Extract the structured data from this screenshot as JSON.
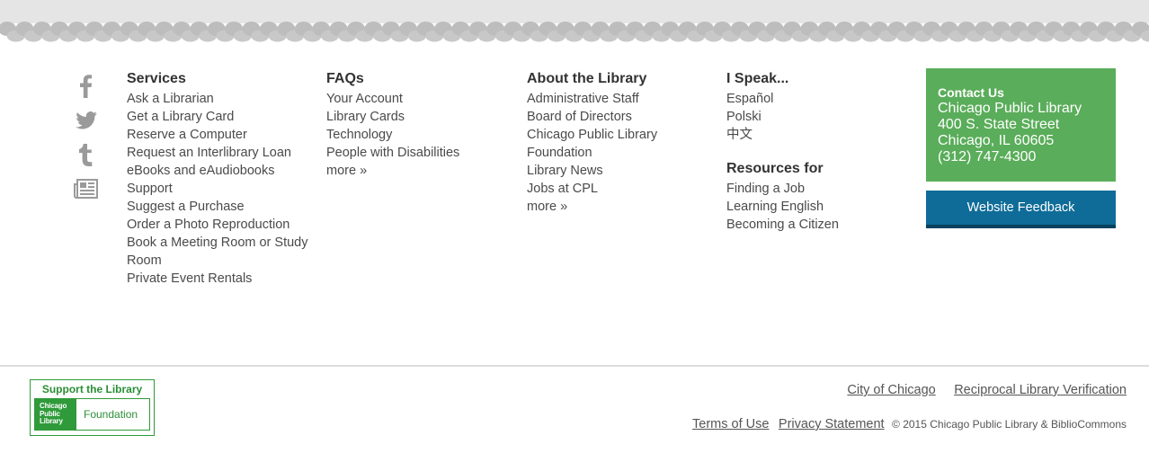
{
  "social": {
    "icons": [
      "facebook-icon",
      "twitter-icon",
      "tumblr-icon",
      "newsletter-icon"
    ]
  },
  "services": {
    "heading": "Services",
    "items": [
      "Ask a Librarian",
      "Get a Library Card",
      "Reserve a Computer",
      "Request an Interlibrary Loan",
      "eBooks and eAudiobooks",
      "Support",
      "Suggest a Purchase",
      "Order a Photo Reproduction",
      "Book a Meeting Room or Study",
      "Room",
      "Private Event Rentals"
    ]
  },
  "faqs": {
    "heading": "FAQs",
    "items": [
      "Your Account",
      "Library Cards",
      "Technology",
      "People with Disabilities",
      "more »"
    ]
  },
  "about": {
    "heading": "About the Library",
    "items": [
      "Administrative Staff",
      "Board of Directors",
      "Chicago Public Library",
      "Foundation",
      "Library News",
      "Jobs at CPL",
      "more »"
    ]
  },
  "speak": {
    "heading": "I Speak...",
    "items": [
      "Español",
      "Polski",
      "中文"
    ]
  },
  "resources": {
    "heading": "Resources for",
    "items": [
      "Finding a Job",
      "Learning English",
      "Becoming a Citizen"
    ]
  },
  "contact": {
    "title": "Contact Us",
    "name": "Chicago Public Library",
    "street": "400 S. State Street",
    "city": "Chicago, IL 60605",
    "phone": "(312) 747-4300",
    "bg_color": "#5aad5a"
  },
  "feedback": {
    "label": "Website Feedback",
    "bg_color": "#0f6c98"
  },
  "support_logo": {
    "top": "Support the Library",
    "mark_line1": "Chicago",
    "mark_line2": "Public",
    "mark_line3": "Library",
    "foundation": "Foundation"
  },
  "footer": {
    "city_link": "City of Chicago",
    "reciprocal_link": "Reciprocal Library Verification",
    "terms_link": "Terms of Use",
    "privacy_link": "Privacy Statement",
    "copyright": "© 2015 Chicago Public Library & BiblioCommons"
  }
}
